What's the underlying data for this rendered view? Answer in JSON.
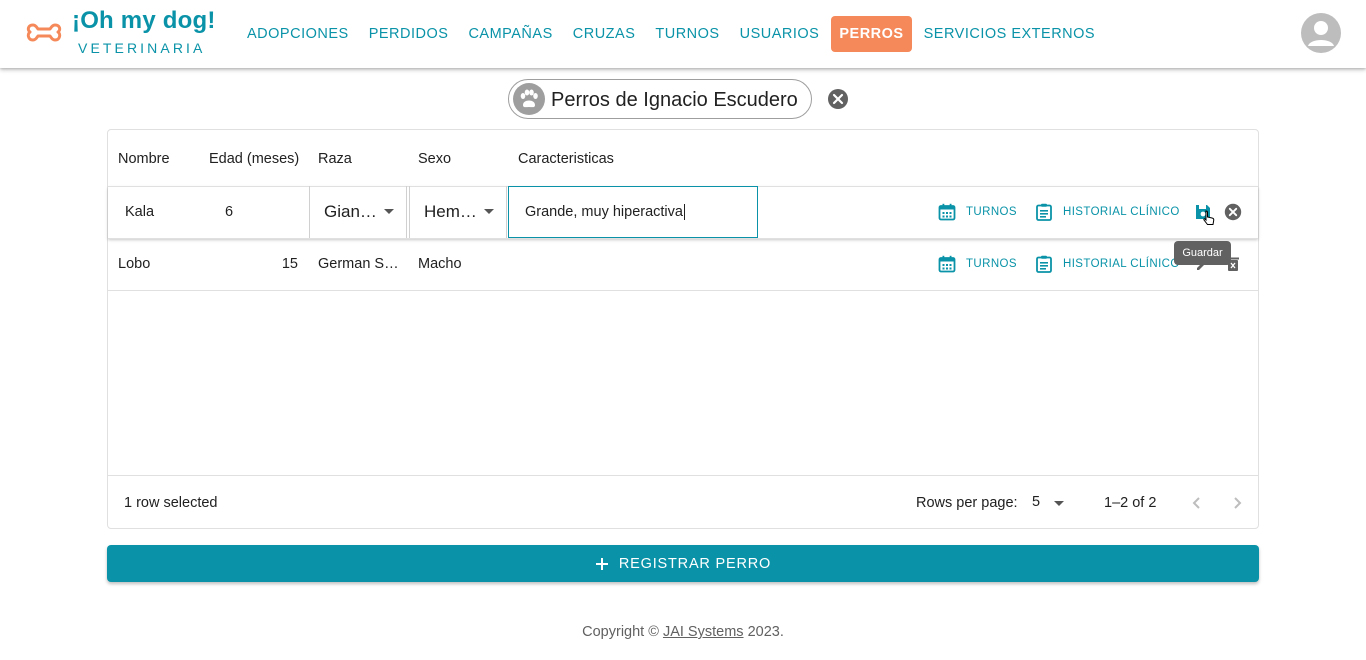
{
  "brand": {
    "title": "¡Oh my dog!",
    "subtitle": "VETERINARIA"
  },
  "nav": {
    "items": [
      "ADOPCIONES",
      "PERDIDOS",
      "CAMPAÑAS",
      "CRUZAS",
      "TURNOS",
      "USUARIOS",
      "PERROS",
      "SERVICIOS EXTERNOS"
    ],
    "active": "PERROS"
  },
  "owner_chip": {
    "label": "Perros de Ignacio Escudero"
  },
  "table": {
    "columns": [
      "Nombre",
      "Edad (meses)",
      "Raza",
      "Sexo",
      "Caracteristicas"
    ],
    "editing_row": {
      "nombre": "Kala",
      "edad": "6",
      "raza": "Gian…",
      "sexo": "Hem…",
      "caracteristicas": "Grande, muy hiperactiva"
    },
    "rows": [
      {
        "nombre": "Lobo",
        "edad": "15",
        "raza": "German S…",
        "sexo": "Macho",
        "caracteristicas": ""
      }
    ],
    "actions": {
      "turnos": "TURNOS",
      "historial": "HISTORIAL CLÍNICO"
    },
    "tooltip": "Guardar",
    "footer": {
      "selected": "1 row selected",
      "rows_per_page_label": "Rows per page:",
      "rows_per_page": "5",
      "range": "1–2 of 2"
    }
  },
  "register_button": "REGISTRAR PERRO",
  "copyright": {
    "prefix": "Copyright ©",
    "company": "JAI Systems",
    "suffix": "2023."
  },
  "colors": {
    "primary": "#0a93a8",
    "accent": "#f5895a"
  }
}
